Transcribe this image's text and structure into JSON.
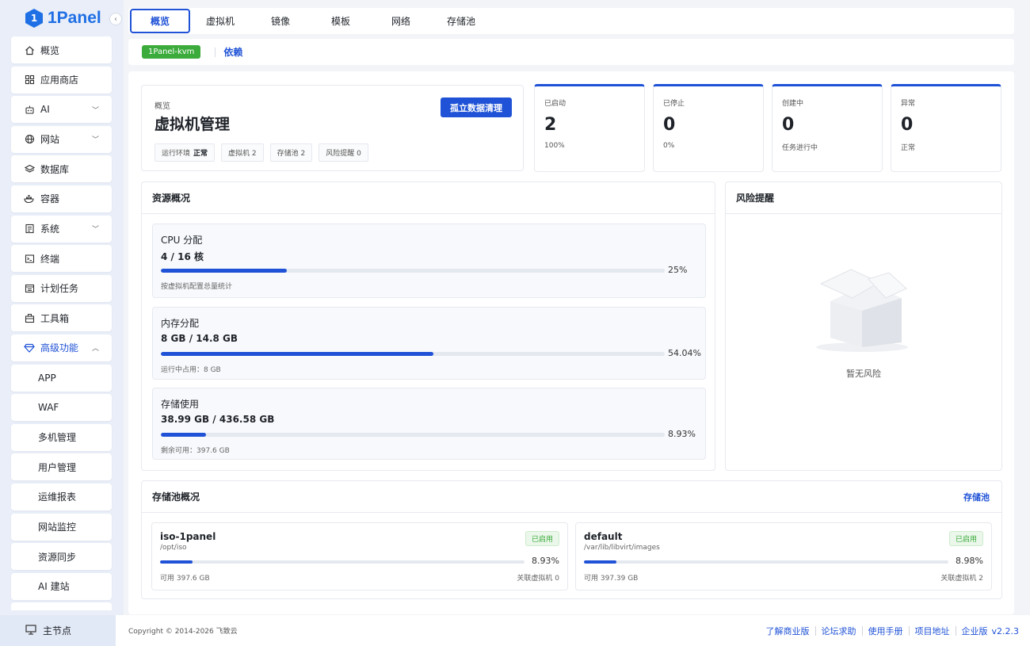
{
  "brand": {
    "name": "1Panel",
    "logo_letter": "1"
  },
  "sidebar": {
    "items": [
      {
        "label": "概览",
        "icon": "home-icon",
        "name": "sidebar-item-overview"
      },
      {
        "label": "应用商店",
        "icon": "grid-icon",
        "name": "sidebar-item-appstore"
      },
      {
        "label": "AI",
        "icon": "robot-icon",
        "name": "sidebar-item-ai",
        "chevron": "down"
      },
      {
        "label": "网站",
        "icon": "globe-icon",
        "name": "sidebar-item-website",
        "chevron": "down"
      },
      {
        "label": "数据库",
        "icon": "layers-icon",
        "name": "sidebar-item-database"
      },
      {
        "label": "容器",
        "icon": "whale-icon",
        "name": "sidebar-item-container"
      },
      {
        "label": "系统",
        "icon": "document-icon",
        "name": "sidebar-item-system",
        "chevron": "down"
      },
      {
        "label": "终端",
        "icon": "terminal-icon",
        "name": "sidebar-item-terminal"
      },
      {
        "label": "计划任务",
        "icon": "calendar-icon",
        "name": "sidebar-item-cron"
      },
      {
        "label": "工具箱",
        "icon": "toolbox-icon",
        "name": "sidebar-item-toolbox"
      },
      {
        "label": "高级功能",
        "icon": "diamond-icon",
        "name": "sidebar-item-advanced",
        "chevron": "up",
        "active": true
      },
      {
        "label": "APP",
        "name": "sidebar-subitem-app",
        "sub": true
      },
      {
        "label": "WAF",
        "name": "sidebar-subitem-waf",
        "sub": true
      },
      {
        "label": "多机管理",
        "name": "sidebar-subitem-multi-node",
        "sub": true
      },
      {
        "label": "用户管理",
        "name": "sidebar-subitem-users",
        "sub": true
      },
      {
        "label": "运维报表",
        "name": "sidebar-subitem-reports",
        "sub": true
      },
      {
        "label": "网站监控",
        "name": "sidebar-subitem-monitor",
        "sub": true
      },
      {
        "label": "资源同步",
        "name": "sidebar-subitem-sync",
        "sub": true
      },
      {
        "label": "AI 建站",
        "name": "sidebar-subitem-ai-site",
        "sub": true
      }
    ],
    "bottom_node": "主节点"
  },
  "tabs": [
    {
      "label": "概览",
      "active": true
    },
    {
      "label": "虚拟机"
    },
    {
      "label": "镜像"
    },
    {
      "label": "模板"
    },
    {
      "label": "网络"
    },
    {
      "label": "存储池"
    }
  ],
  "subbar": {
    "tag": "1Panel-kvm",
    "link": "依赖"
  },
  "overview": {
    "label": "概览",
    "title": "虚拟机管理",
    "button": "孤立数据清理",
    "tags": [
      {
        "text": "运行环境",
        "strong": "正常"
      },
      {
        "text": "虚拟机 2"
      },
      {
        "text": "存储池 2"
      },
      {
        "text": "风险提醒 0"
      }
    ]
  },
  "stats": [
    {
      "label": "已启动",
      "value": "2",
      "sub": "100%"
    },
    {
      "label": "已停止",
      "value": "0",
      "sub": "0%"
    },
    {
      "label": "创建中",
      "value": "0",
      "sub": "任务进行中"
    },
    {
      "label": "异常",
      "value": "0",
      "sub": "正常"
    }
  ],
  "resources": {
    "title": "资源概况",
    "items": [
      {
        "title": "CPU 分配",
        "value": "4 / 16 核",
        "percent": 25,
        "percent_label": "25%",
        "note": "按虚拟机配置总量统计"
      },
      {
        "title": "内存分配",
        "value": "8 GB / 14.8 GB",
        "percent": 54.04,
        "percent_label": "54.04%",
        "note": "运行中占用：8 GB"
      },
      {
        "title": "存储使用",
        "value": "38.99 GB / 436.58 GB",
        "percent": 8.93,
        "percent_label": "8.93%",
        "note": "剩余可用：397.6 GB"
      }
    ]
  },
  "risk": {
    "title": "风险提醒",
    "empty_text": "暂无风险"
  },
  "pools": {
    "title": "存储池概况",
    "link": "存储池",
    "items": [
      {
        "name": "iso-1panel",
        "path": "/opt/iso",
        "status": "已启用",
        "percent": 8.93,
        "percent_label": "8.93%",
        "available": "可用 397.6 GB",
        "vms": "关联虚拟机 0"
      },
      {
        "name": "default",
        "path": "/var/lib/libvirt/images",
        "status": "已启用",
        "percent": 8.98,
        "percent_label": "8.98%",
        "available": "可用 397.39 GB",
        "vms": "关联虚拟机 2"
      }
    ]
  },
  "footer": {
    "copyright": "Copyright © 2014-2026 飞致云",
    "links": [
      "了解商业版",
      "论坛求助",
      "使用手册",
      "项目地址",
      "企业版"
    ],
    "version": "v2.2.3"
  },
  "colors": {
    "accent": "#1f52d6",
    "success": "#3bab3b"
  }
}
